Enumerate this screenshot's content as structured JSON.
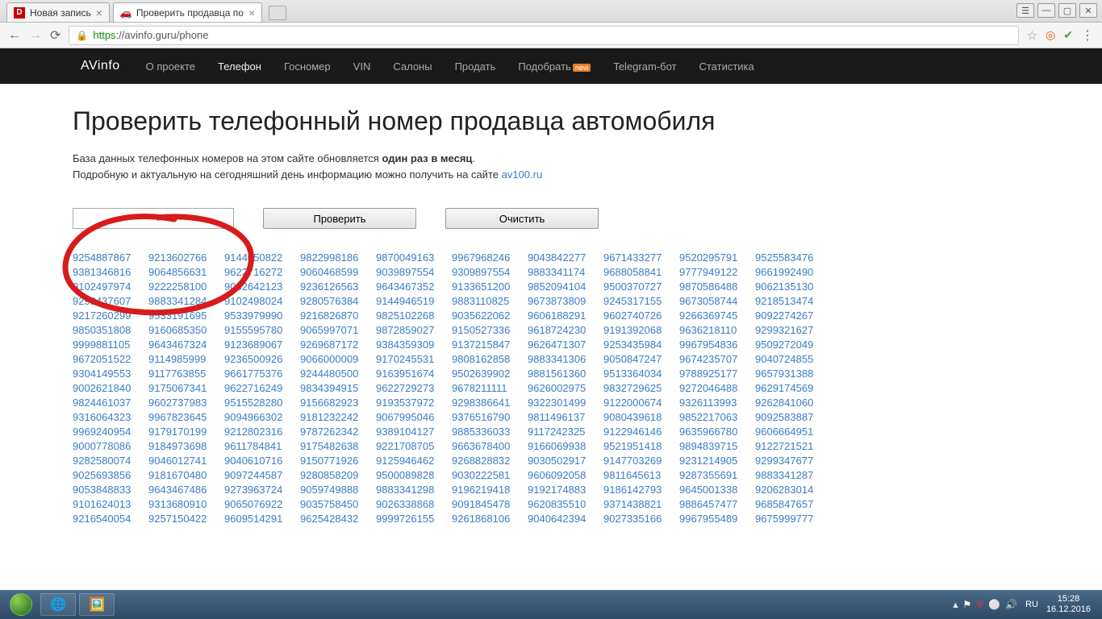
{
  "browser": {
    "tabs": [
      {
        "title": "Новая запись",
        "favicon": "D",
        "active": false
      },
      {
        "title": "Проверить продавца по",
        "favicon": "🚗",
        "active": true
      }
    ],
    "url_proto": "https",
    "url_rest": "://avinfo.guru/phone"
  },
  "nav": {
    "brand": "AVinfo",
    "items": [
      "О проекте",
      "Телефон",
      "Госномер",
      "VIN",
      "Салоны",
      "Продать",
      "Подобрать",
      "Telegram-бот",
      "Статистика"
    ],
    "new_badge": "new"
  },
  "page": {
    "title": "Проверить телефонный номер продавца автомобиля",
    "desc_line1_a": "База данных телефонных номеров на этом сайте обновляется ",
    "desc_line1_b": "один раз в месяц",
    "desc_line1_c": ".",
    "desc_line2_a": "Подробную и актуальную на сегодняшний день информацию можно получить на сайте ",
    "desc_link": "av100.ru",
    "btn_check": "Проверить",
    "btn_clear": "Очистить",
    "phones": [
      "9254887867",
      "9213602766",
      "9144050822",
      "9822998186",
      "9870049163",
      "9967968246",
      "9043842277",
      "9671433277",
      "9520295791",
      "9525583476",
      "9381346816",
      "9064856631",
      "9622716272",
      "9060468599",
      "9039897554",
      "9309897554",
      "9883341174",
      "9688058841",
      "9777949122",
      "9661992490",
      "9102497974",
      "9222258100",
      "9082642123",
      "9236126563",
      "9643467352",
      "9133651200",
      "9852094104",
      "9500370727",
      "9870586488",
      "9062135130",
      "9298437607",
      "9883341284",
      "9102498024",
      "9280576384",
      "9144946519",
      "9883110825",
      "9673873809",
      "9245317155",
      "9673058744",
      "9218513474",
      "9217260299",
      "9533191695",
      "9533979990",
      "9216826870",
      "9825102268",
      "9035622062",
      "9606188291",
      "9602740726",
      "9266369745",
      "9092274267",
      "9850351808",
      "9160685350",
      "9155595780",
      "9065997071",
      "9872859027",
      "9150527336",
      "9618724230",
      "9191392068",
      "9636218110",
      "9299321627",
      "9999881105",
      "9643467324",
      "9123689067",
      "9269687172",
      "9384359309",
      "9137215847",
      "9626471307",
      "9253435984",
      "9967954836",
      "9509272049",
      "9672051522",
      "9114985999",
      "9236500926",
      "9066000009",
      "9170245531",
      "9808162858",
      "9883341306",
      "9050847247",
      "9674235707",
      "9040724855",
      "9304149553",
      "9117763855",
      "9661775376",
      "9244480500",
      "9163951674",
      "9502639902",
      "9881561360",
      "9513364034",
      "9788925177",
      "9657931388",
      "9002621840",
      "9175067341",
      "9622716249",
      "9834394915",
      "9622729273",
      "9678211111",
      "9626002975",
      "9832729625",
      "9272046488",
      "9629174569",
      "9824461037",
      "9602737983",
      "9515528280",
      "9156682923",
      "9193537972",
      "9298386641",
      "9322301499",
      "9122000674",
      "9326113993",
      "9262841060",
      "9316064323",
      "9967823645",
      "9094966302",
      "9181232242",
      "9067995046",
      "9376516790",
      "9811496137",
      "9080439618",
      "9852217063",
      "9092583887",
      "9969240954",
      "9179170199",
      "9212802316",
      "9787262342",
      "9389104127",
      "9885336033",
      "9117242325",
      "9122946146",
      "9635966780",
      "9606664951",
      "9000778086",
      "9184973698",
      "9611784841",
      "9175482638",
      "9221708705",
      "9663678400",
      "9166069938",
      "9521951418",
      "9894839715",
      "9122721521",
      "9282580074",
      "9046012741",
      "9040610716",
      "9150771926",
      "9125946462",
      "9268828832",
      "9030502917",
      "9147703269",
      "9231214905",
      "9299347677",
      "9025693856",
      "9181670480",
      "9097244587",
      "9280858209",
      "9500089828",
      "9030222581",
      "9606092058",
      "9811645613",
      "9287355691",
      "9883341287",
      "9053848833",
      "9643467486",
      "9273963724",
      "9059749888",
      "9883341298",
      "9196219418",
      "9192174883",
      "9186142793",
      "9645001338",
      "9206283014",
      "9101624013",
      "9313680910",
      "9065076922",
      "9035758450",
      "9026338868",
      "9091845478",
      "9620835510",
      "9371438821",
      "9886457477",
      "9685847657",
      "9216540054",
      "9257150422",
      "9609514291",
      "9625428432",
      "9999726155",
      "9261868106",
      "9040642394",
      "9027335166",
      "9967955489",
      "9675999777"
    ]
  },
  "taskbar": {
    "lang": "RU",
    "time": "15:28",
    "date": "16.12.2016"
  }
}
